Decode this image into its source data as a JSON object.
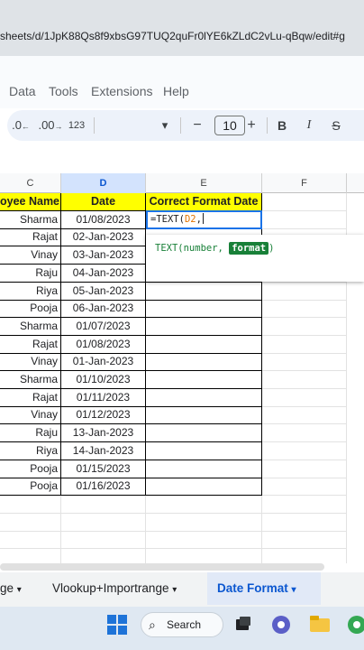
{
  "browser": {
    "url": "sheets/d/1JpK88Qs8f9xbsG97TUQ2quFr0lYE6kZLdC2vLu-qBqw/edit#g"
  },
  "menu": {
    "items": [
      "Data",
      "Tools",
      "Extensions",
      "Help"
    ]
  },
  "toolbar": {
    "decrease_decimal": ".0",
    "increase_decimal": ".00",
    "number_format": "123",
    "font_dropdown_arrow": "▾",
    "minus": "−",
    "font_size": "10",
    "plus": "+",
    "bold": "B",
    "italic": "I",
    "strike": "S"
  },
  "columns": {
    "headers": [
      "C",
      "D",
      "E",
      "F"
    ]
  },
  "sheet": {
    "header_row": [
      "oyee Name",
      "Date",
      "Correct Format Date"
    ],
    "rows": [
      [
        "Sharma",
        "01/08/2023"
      ],
      [
        "Rajat",
        "02-Jan-2023"
      ],
      [
        "Vinay",
        "03-Jan-2023"
      ],
      [
        "Raju",
        "04-Jan-2023"
      ],
      [
        "Riya",
        "05-Jan-2023"
      ],
      [
        "Pooja",
        "06-Jan-2023"
      ],
      [
        "Sharma",
        "01/07/2023"
      ],
      [
        "Rajat",
        "01/08/2023"
      ],
      [
        "Vinay",
        "01-Jan-2023"
      ],
      [
        "Sharma",
        "01/10/2023"
      ],
      [
        "Rajat",
        "01/11/2023"
      ],
      [
        "Vinay",
        "01/12/2023"
      ],
      [
        "Raju",
        "13-Jan-2023"
      ],
      [
        "Riya",
        "14-Jan-2023"
      ],
      [
        "Pooja",
        "01/15/2023"
      ],
      [
        "Pooja",
        "01/16/2023"
      ]
    ],
    "active_cell": {
      "prefix": "=TEXT(",
      "ref": "D2",
      "suffix": ","
    }
  },
  "tooltip": {
    "prefix": "TEXT(number, ",
    "highlight": "format",
    "suffix": ")"
  },
  "sheet_tabs": [
    {
      "label": "ge",
      "arrow": "▾"
    },
    {
      "label": "Vlookup+Importrange",
      "arrow": "▾"
    },
    {
      "label": "Date Format",
      "arrow": "▾"
    }
  ],
  "taskbar": {
    "search_label": "Search"
  },
  "colors": {
    "header_fill": "#ffff00",
    "selection_blue": "#1a73e8",
    "tooltip_green": "#188038",
    "active_tab": "#0b57d0"
  }
}
